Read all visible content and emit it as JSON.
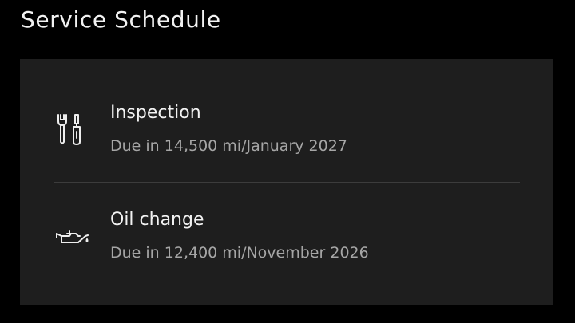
{
  "screen": {
    "title": "Service Schedule"
  },
  "items": [
    {
      "icon": "wrench-screwdriver-icon",
      "title": "Inspection",
      "subtitle": "Due in 14,500 mi/January 2027"
    },
    {
      "icon": "oil-can-icon",
      "title": "Oil change",
      "subtitle": "Due in 12,400 mi/November 2026"
    }
  ],
  "colors": {
    "background": "#000000",
    "panel": "#1e1e1e",
    "primary_text": "#f2f2f2",
    "secondary_text": "#a6a6a6",
    "divider": "#3c3c3c"
  }
}
